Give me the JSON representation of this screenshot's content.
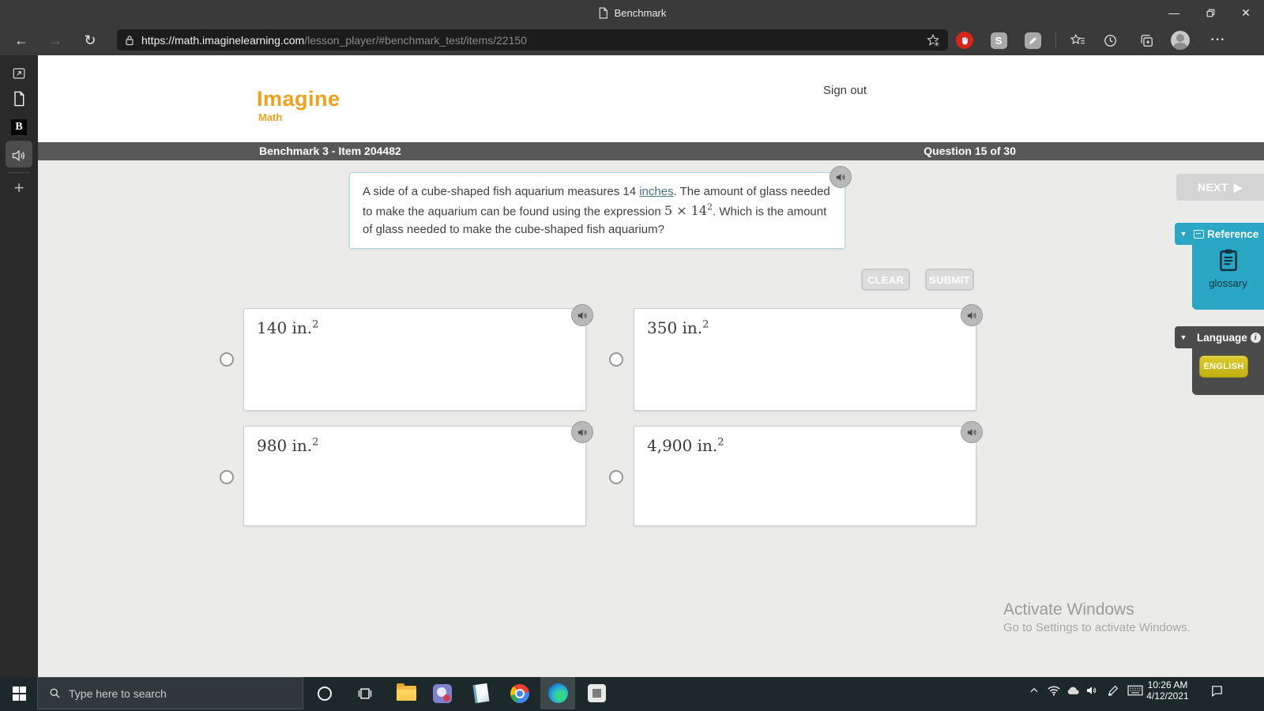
{
  "window": {
    "title": "Benchmark"
  },
  "browser": {
    "url_host": "https://math.imaginelearning.com",
    "url_path": "/lesson_player/#benchmark_test/items/22150",
    "extension_s": "S"
  },
  "page": {
    "logo_primary": "Imagine",
    "logo_secondary": "Math",
    "sign_out": "Sign out",
    "status_left": "Benchmark 3 - Item 204482",
    "status_right": "Question 15 of 30",
    "question": {
      "part1": "A side of a cube-shaped fish aquarium measures 14 ",
      "link": "inches",
      "part2": ". The amount of glass needed to make the aquarium can be found using the expression ",
      "math_base": "5 × 14",
      "math_exp": "2",
      "part3": ". Which is the amount of glass needed to make the cube-shaped fish aquarium?"
    },
    "clear_label": "CLEAR",
    "submit_label": "SUBMIT",
    "next_label": "NEXT",
    "answers": [
      {
        "text": "140 in.",
        "exp": "2"
      },
      {
        "text": "350 in.",
        "exp": "2"
      },
      {
        "text": "980 in.",
        "exp": "2"
      },
      {
        "text": "4,900 in.",
        "exp": "2"
      }
    ],
    "reference": {
      "title": "Reference",
      "item": "glossary"
    },
    "language": {
      "title": "Language",
      "selected": "ENGLISH"
    },
    "watermark_line1": "Activate Windows",
    "watermark_line2": "Go to Settings to activate Windows."
  },
  "taskbar": {
    "search_placeholder": "Type here to search",
    "time": "10:26 AM",
    "date": "4/12/2021"
  },
  "colors": {
    "brand_orange": "#f0a11c",
    "reference_teal": "#2aa7c4",
    "language_gray": "#4b4b4b",
    "english_yellow": "#cfbd17",
    "status_bar_gray": "#585858",
    "browser_chrome": "#3a3a3a",
    "taskbar_dark": "#1d282b"
  }
}
